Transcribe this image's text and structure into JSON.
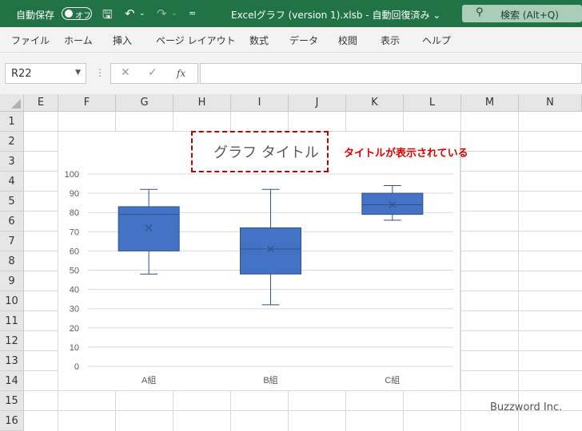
{
  "titlebar": {
    "autosave_label": "自動保存",
    "autosave_state": "オフ",
    "doc_title": "Excelグラフ (version 1).xlsb  -  自動回復済み  ⌄",
    "search_label": "検索 (Alt+Q)",
    "icons": [
      "save-icon",
      "undo-icon",
      "redo-icon",
      "customize-icon",
      "search-icon"
    ]
  },
  "menu": [
    "ファイル",
    "ホーム",
    "挿入",
    "ページ レイアウト",
    "数式",
    "データ",
    "校閲",
    "表示",
    "ヘルプ"
  ],
  "formula": {
    "name_box": "R22",
    "fx": "fx",
    "value": ""
  },
  "columns": [
    "E",
    "F",
    "G",
    "H",
    "I",
    "J",
    "K",
    "L",
    "M",
    "N"
  ],
  "rows": [
    "1",
    "2",
    "3",
    "4",
    "5",
    "6",
    "7",
    "8",
    "9",
    "10",
    "11",
    "12",
    "13",
    "14",
    "15",
    "16"
  ],
  "chart_data": {
    "type": "boxplot",
    "title": "グラフ タイトル",
    "xlabel": "",
    "ylabel": "",
    "ylim": [
      0,
      100
    ],
    "yticks": [
      0,
      10,
      20,
      30,
      40,
      50,
      60,
      70,
      80,
      90,
      100
    ],
    "categories": [
      "A組",
      "B組",
      "C組"
    ],
    "boxes": [
      {
        "category": "A組",
        "min": 48,
        "q1": 60,
        "median": 79,
        "q3": 83,
        "max": 92,
        "mean": 72
      },
      {
        "category": "B組",
        "min": 32,
        "q1": 48,
        "median": 61,
        "q3": 72,
        "max": 92,
        "mean": 61
      },
      {
        "category": "C組",
        "min": 76,
        "q1": 79,
        "median": 84,
        "q3": 90,
        "max": 94,
        "mean": 84
      }
    ],
    "grid": true,
    "legend": "none",
    "box_color": "#4472C4",
    "line_color": "#2F528F"
  },
  "annotation": "タイトルが表示されている",
  "watermark": "Buzzword Inc.",
  "colors": {
    "titlebar": "#217346",
    "highlight": "#C00000",
    "annotation": "#E00000"
  }
}
